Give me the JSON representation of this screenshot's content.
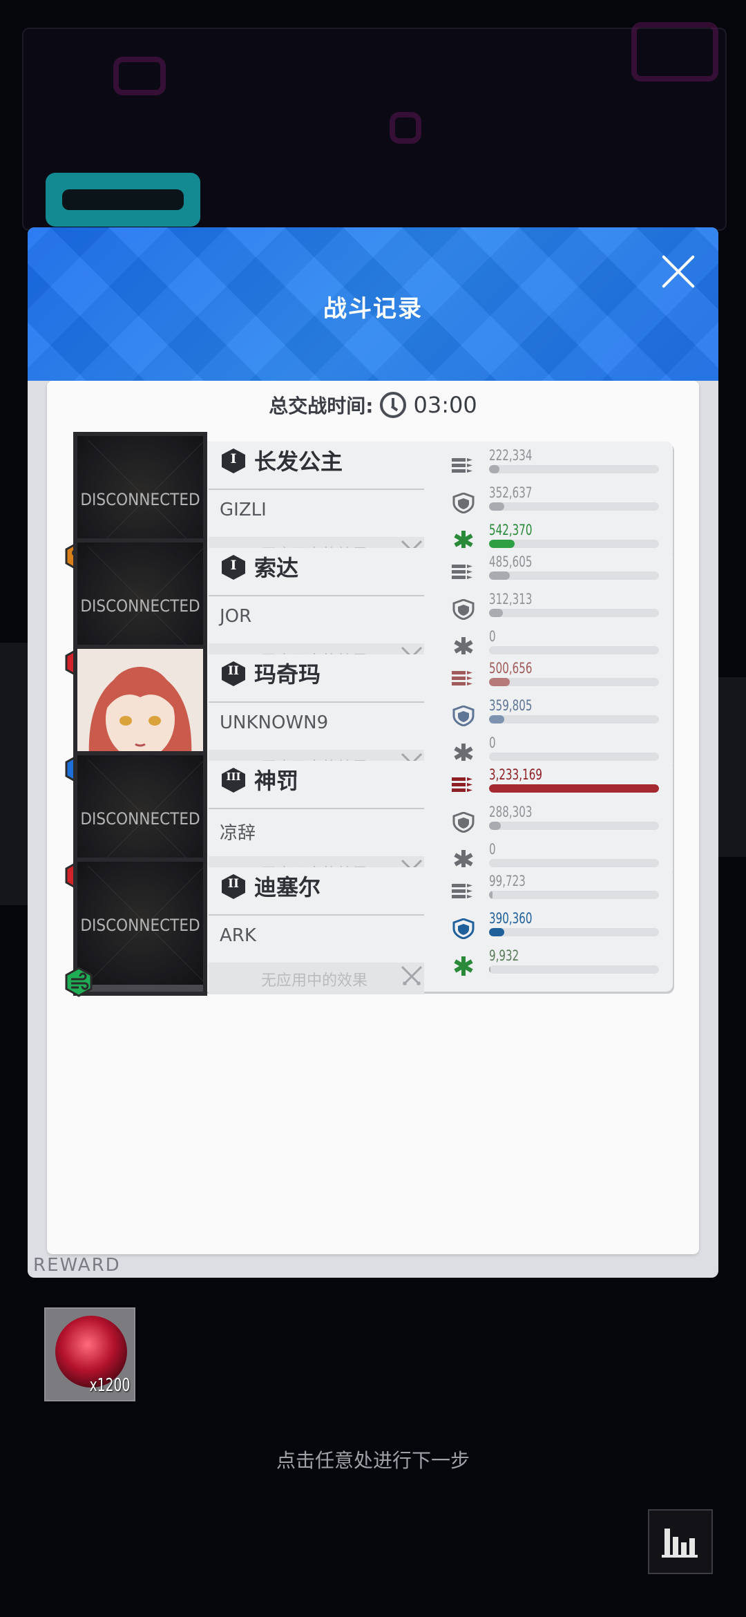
{
  "modal": {
    "title": "战斗记录"
  },
  "total": {
    "label": "总交战时间:",
    "time": "03:00"
  },
  "effect_label": "无应用中的效果",
  "disconnected_label": "DISCONNECTED",
  "reward": {
    "count": "x1200"
  },
  "hint": "点击任意处进行下一步",
  "units": [
    {
      "rank": "I",
      "name": "长发公主",
      "player": "GIZLI",
      "element": "fire-element",
      "portrait": "disconnected",
      "damage": "222,334",
      "damage_pct": 6,
      "defense": "352,637",
      "defense_pct": 9,
      "heal": "542,370",
      "heal_pct": 15,
      "damage_color": "#a9abb0",
      "defense_color": "#a9abb0",
      "heal_color": "#2ea043",
      "dmg_text_color": "#8f9197",
      "def_text_color": "#8f9197",
      "heal_text_color": "#2a8a3a",
      "heal_icon_color": "#2a8a3a"
    },
    {
      "rank": "I",
      "name": "索达",
      "player": "JOR",
      "element": "burn-element",
      "portrait": "disconnected",
      "damage": "485,605",
      "damage_pct": 12,
      "defense": "312,313",
      "defense_pct": 8,
      "heal": "0",
      "heal_pct": 0,
      "damage_color": "#a9abb0",
      "defense_color": "#a9abb0",
      "heal_color": "#a9abb0",
      "dmg_text_color": "#8f9197",
      "def_text_color": "#8f9197",
      "heal_text_color": "#8f9197",
      "heal_icon_color": "#6b6d72"
    },
    {
      "rank": "II",
      "name": "玛奇玛",
      "player": "UNKNOWN9",
      "element": "water-element",
      "portrait": "makima",
      "damage": "500,656",
      "damage_pct": 12,
      "defense": "359,805",
      "defense_pct": 9,
      "heal": "0",
      "heal_pct": 0,
      "damage_color": "#b77a7a",
      "defense_color": "#7d93b0",
      "heal_color": "#a9abb0",
      "dmg_text_color": "#a05a5a",
      "def_text_color": "#5e7595",
      "heal_text_color": "#8f9197",
      "heal_icon_color": "#6b6d72"
    },
    {
      "rank": "III",
      "name": "神罚",
      "player": "凉辞",
      "element": "burn-element",
      "portrait": "disconnected",
      "damage": "3,233,169",
      "damage_pct": 100,
      "defense": "288,303",
      "defense_pct": 7,
      "heal": "0",
      "heal_pct": 0,
      "damage_color": "#a52a2f",
      "defense_color": "#a9abb0",
      "heal_color": "#a9abb0",
      "dmg_text_color": "#8e1f25",
      "def_text_color": "#8f9197",
      "heal_text_color": "#8f9197",
      "heal_icon_color": "#6b6d72"
    },
    {
      "rank": "II",
      "name": "迪塞尔",
      "player": "ARK",
      "element": "wind-element",
      "portrait": "disconnected",
      "damage": "99,723",
      "damage_pct": 2,
      "defense": "390,360",
      "defense_pct": 9,
      "heal": "9,932",
      "heal_pct": 1,
      "damage_color": "#a9abb0",
      "defense_color": "#1f5f9a",
      "heal_color": "#a9abb0",
      "dmg_text_color": "#8f9197",
      "def_text_color": "#1f5f9a",
      "heal_text_color": "#5a7a5a",
      "heal_icon_color": "#2a8a3a"
    }
  ]
}
